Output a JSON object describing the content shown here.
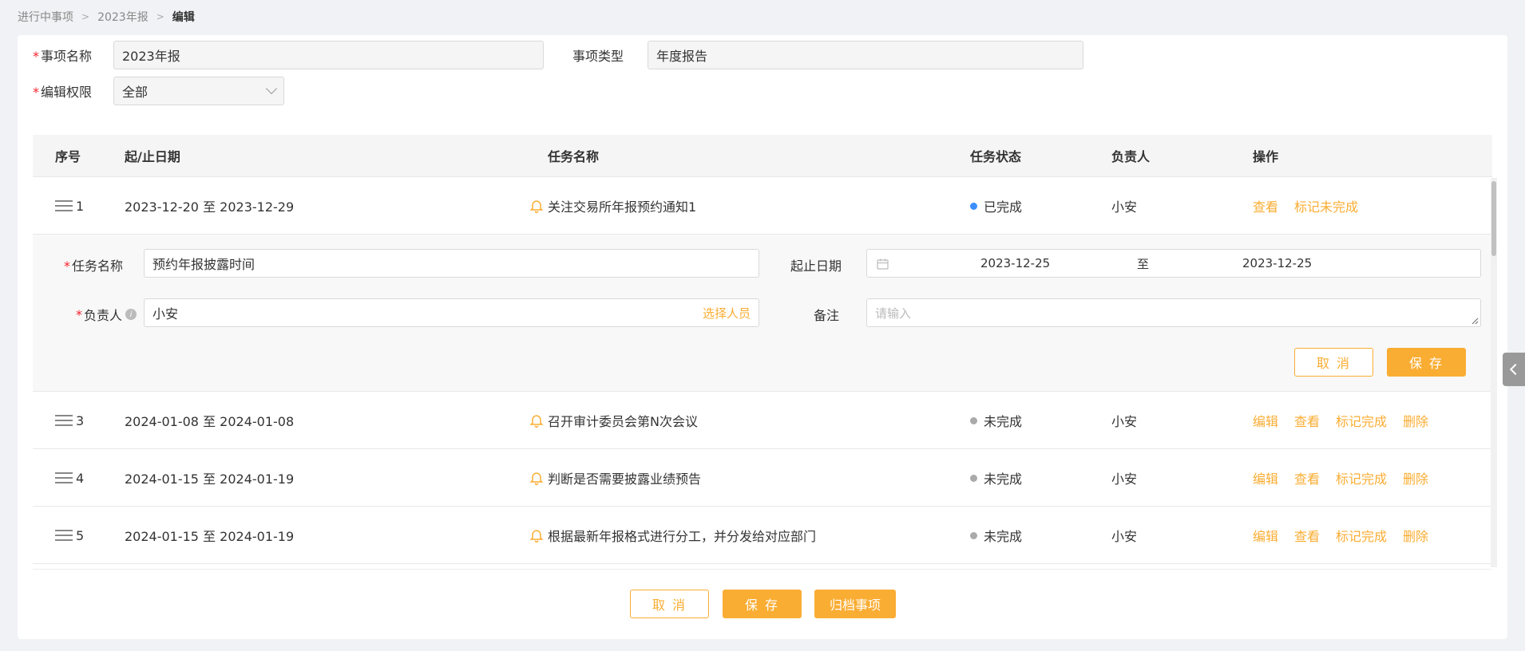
{
  "breadcrumb": {
    "items": [
      "进行中事项",
      "2023年报",
      "编辑"
    ]
  },
  "form": {
    "name_label": "事项名称",
    "name_value": "2023年报",
    "type_label": "事项类型",
    "type_value": "年度报告",
    "permission_label": "编辑权限",
    "permission_value": "全部"
  },
  "table": {
    "headers": [
      "序号",
      "起/止日期",
      "任务名称",
      "任务状态",
      "负责人",
      "操作"
    ],
    "rows": [
      {
        "index": "1",
        "dates": "2023-12-20 至 2023-12-29",
        "task": "关注交易所年报预约通知1",
        "status": "已完成",
        "status_color": "#3b8eff",
        "owner": "小安",
        "ops": [
          "查看",
          "标记未完成"
        ]
      },
      {
        "index": "3",
        "dates": "2024-01-08 至 2024-01-08",
        "task": "召开审计委员会第N次会议",
        "status": "未完成",
        "status_color": "#aaaaaa",
        "owner": "小安",
        "ops": [
          "编辑",
          "查看",
          "标记完成",
          "删除"
        ]
      },
      {
        "index": "4",
        "dates": "2024-01-15 至 2024-01-19",
        "task": "判断是否需要披露业绩预告",
        "status": "未完成",
        "status_color": "#aaaaaa",
        "owner": "小安",
        "ops": [
          "编辑",
          "查看",
          "标记完成",
          "删除"
        ]
      },
      {
        "index": "5",
        "dates": "2024-01-15 至 2024-01-19",
        "task": "根据最新年报格式进行分工，并分发给对应部门",
        "status": "未完成",
        "status_color": "#aaaaaa",
        "owner": "小安",
        "ops": [
          "编辑",
          "查看",
          "标记完成",
          "删除"
        ]
      }
    ]
  },
  "edit_panel": {
    "task_name_label": "任务名称",
    "task_name_value": "预约年报披露时间",
    "date_label": "起止日期",
    "date_start": "2023-12-25",
    "date_sep": "至",
    "date_end": "2023-12-25",
    "owner_label": "负责人",
    "owner_value": "小安",
    "select_person": "选择人员",
    "note_label": "备注",
    "note_placeholder": "请输入",
    "cancel": "取 消",
    "save": "保 存"
  },
  "footer": {
    "cancel": "取 消",
    "save": "保 存",
    "archive": "归档事项"
  },
  "colors": {
    "accent": "#faad33",
    "required": "#f5222d"
  }
}
